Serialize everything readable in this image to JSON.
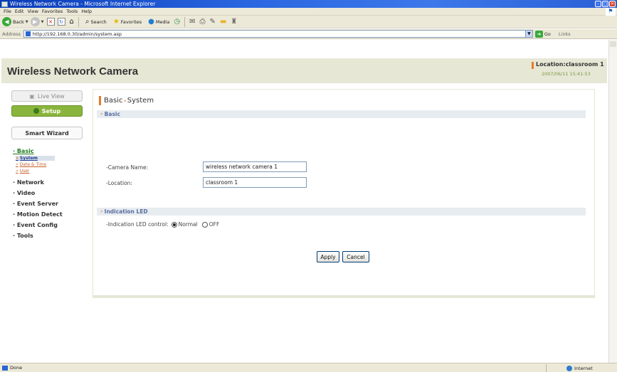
{
  "window": {
    "title": "Wireless Network Camera - Microsoft Internet Explorer"
  },
  "menu": [
    "File",
    "Edit",
    "View",
    "Favorites",
    "Tools",
    "Help"
  ],
  "toolbar": {
    "back": "Back",
    "search": "Search",
    "favorites": "Favorites",
    "media": "Media"
  },
  "address": {
    "label": "Address",
    "url": "http://192.168.0.30/admin/system.asp",
    "go": "Go",
    "links": "Links"
  },
  "header": {
    "title": "Wireless Network Camera",
    "location": "Location:classroom 1",
    "datetime": "2007/06/11 15:41:53"
  },
  "sidebar": {
    "live_view": "Live View",
    "setup": "Setup",
    "smart_wizard": "Smart Wizard",
    "basic": "· Basic",
    "basic_subs": [
      "System",
      "Date & Time",
      "User"
    ],
    "nav": [
      "· Network",
      "· Video",
      "· Event Server",
      "· Motion Detect",
      "· Event Config",
      "· Tools"
    ]
  },
  "main": {
    "title_part1": "Basic",
    "title_sep": "»",
    "title_part2": "System",
    "section_basic": "Basic",
    "camera_name_label": "-Camera Name:",
    "camera_name_value": "wireless network camera 1",
    "location_label": "-Location:",
    "location_value": "classroom 1",
    "section_led": "Indication LED",
    "led_label": "-Indication LED control:",
    "led_normal": "Normal",
    "led_off": "OFF",
    "led_selected": "Normal",
    "apply": "Apply",
    "cancel": "Cancel"
  },
  "status": {
    "text": "Done",
    "zone": "Internet"
  },
  "colors": {
    "accent": "#e87a2a",
    "setup_green": "#8ab53c",
    "header_bg": "#e7e7d6",
    "band_bg": "#e7ecf1"
  }
}
